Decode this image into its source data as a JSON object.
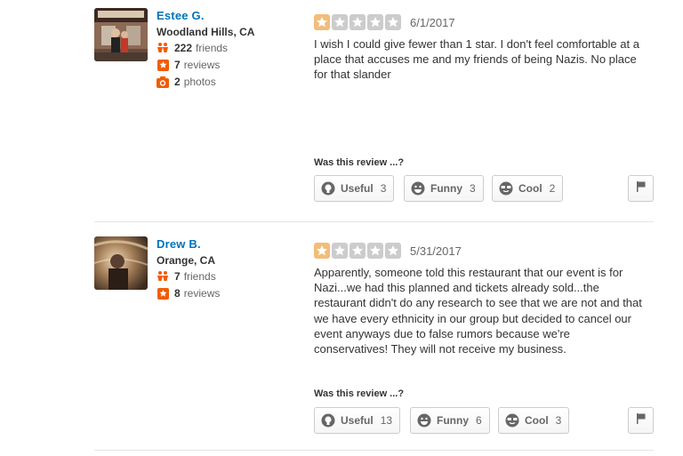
{
  "colors": {
    "star_filled": "#f2bd79",
    "star_empty": "#cccccc",
    "link": "#0073bb",
    "accent": "#f15c00"
  },
  "reviews": [
    {
      "user": {
        "name": "Estee G.",
        "location": "Woodland Hills, CA",
        "friends_count": "222",
        "friends_label": "friends",
        "reviews_count": "7",
        "reviews_label": "reviews",
        "photos_count": "2",
        "photos_label": "photos"
      },
      "rating": 1,
      "date": "6/1/2017",
      "text": "I wish I could give fewer than 1 star.  I don't feel comfortable at a place that accuses me and my friends of being Nazis.  No place for that slander",
      "was_label": "Was this review ...?",
      "votes": {
        "useful": {
          "label": "Useful",
          "count": "3"
        },
        "funny": {
          "label": "Funny",
          "count": "3"
        },
        "cool": {
          "label": "Cool",
          "count": "2"
        }
      }
    },
    {
      "user": {
        "name": "Drew B.",
        "location": "Orange, CA",
        "friends_count": "7",
        "friends_label": "friends",
        "reviews_count": "8",
        "reviews_label": "reviews"
      },
      "rating": 1,
      "date": "5/31/2017",
      "text": "Apparently, someone told this restaurant that our event is for Nazi...we had this planned and tickets already sold...the restaurant didn't do any research to see that we are not and that we have every ethnicity in our group but decided to cancel our event anyways due to false rumors because we're conservatives! They will not receive my business.",
      "was_label": "Was this review ...?",
      "votes": {
        "useful": {
          "label": "Useful",
          "count": "13"
        },
        "funny": {
          "label": "Funny",
          "count": "6"
        },
        "cool": {
          "label": "Cool",
          "count": "3"
        }
      }
    }
  ]
}
